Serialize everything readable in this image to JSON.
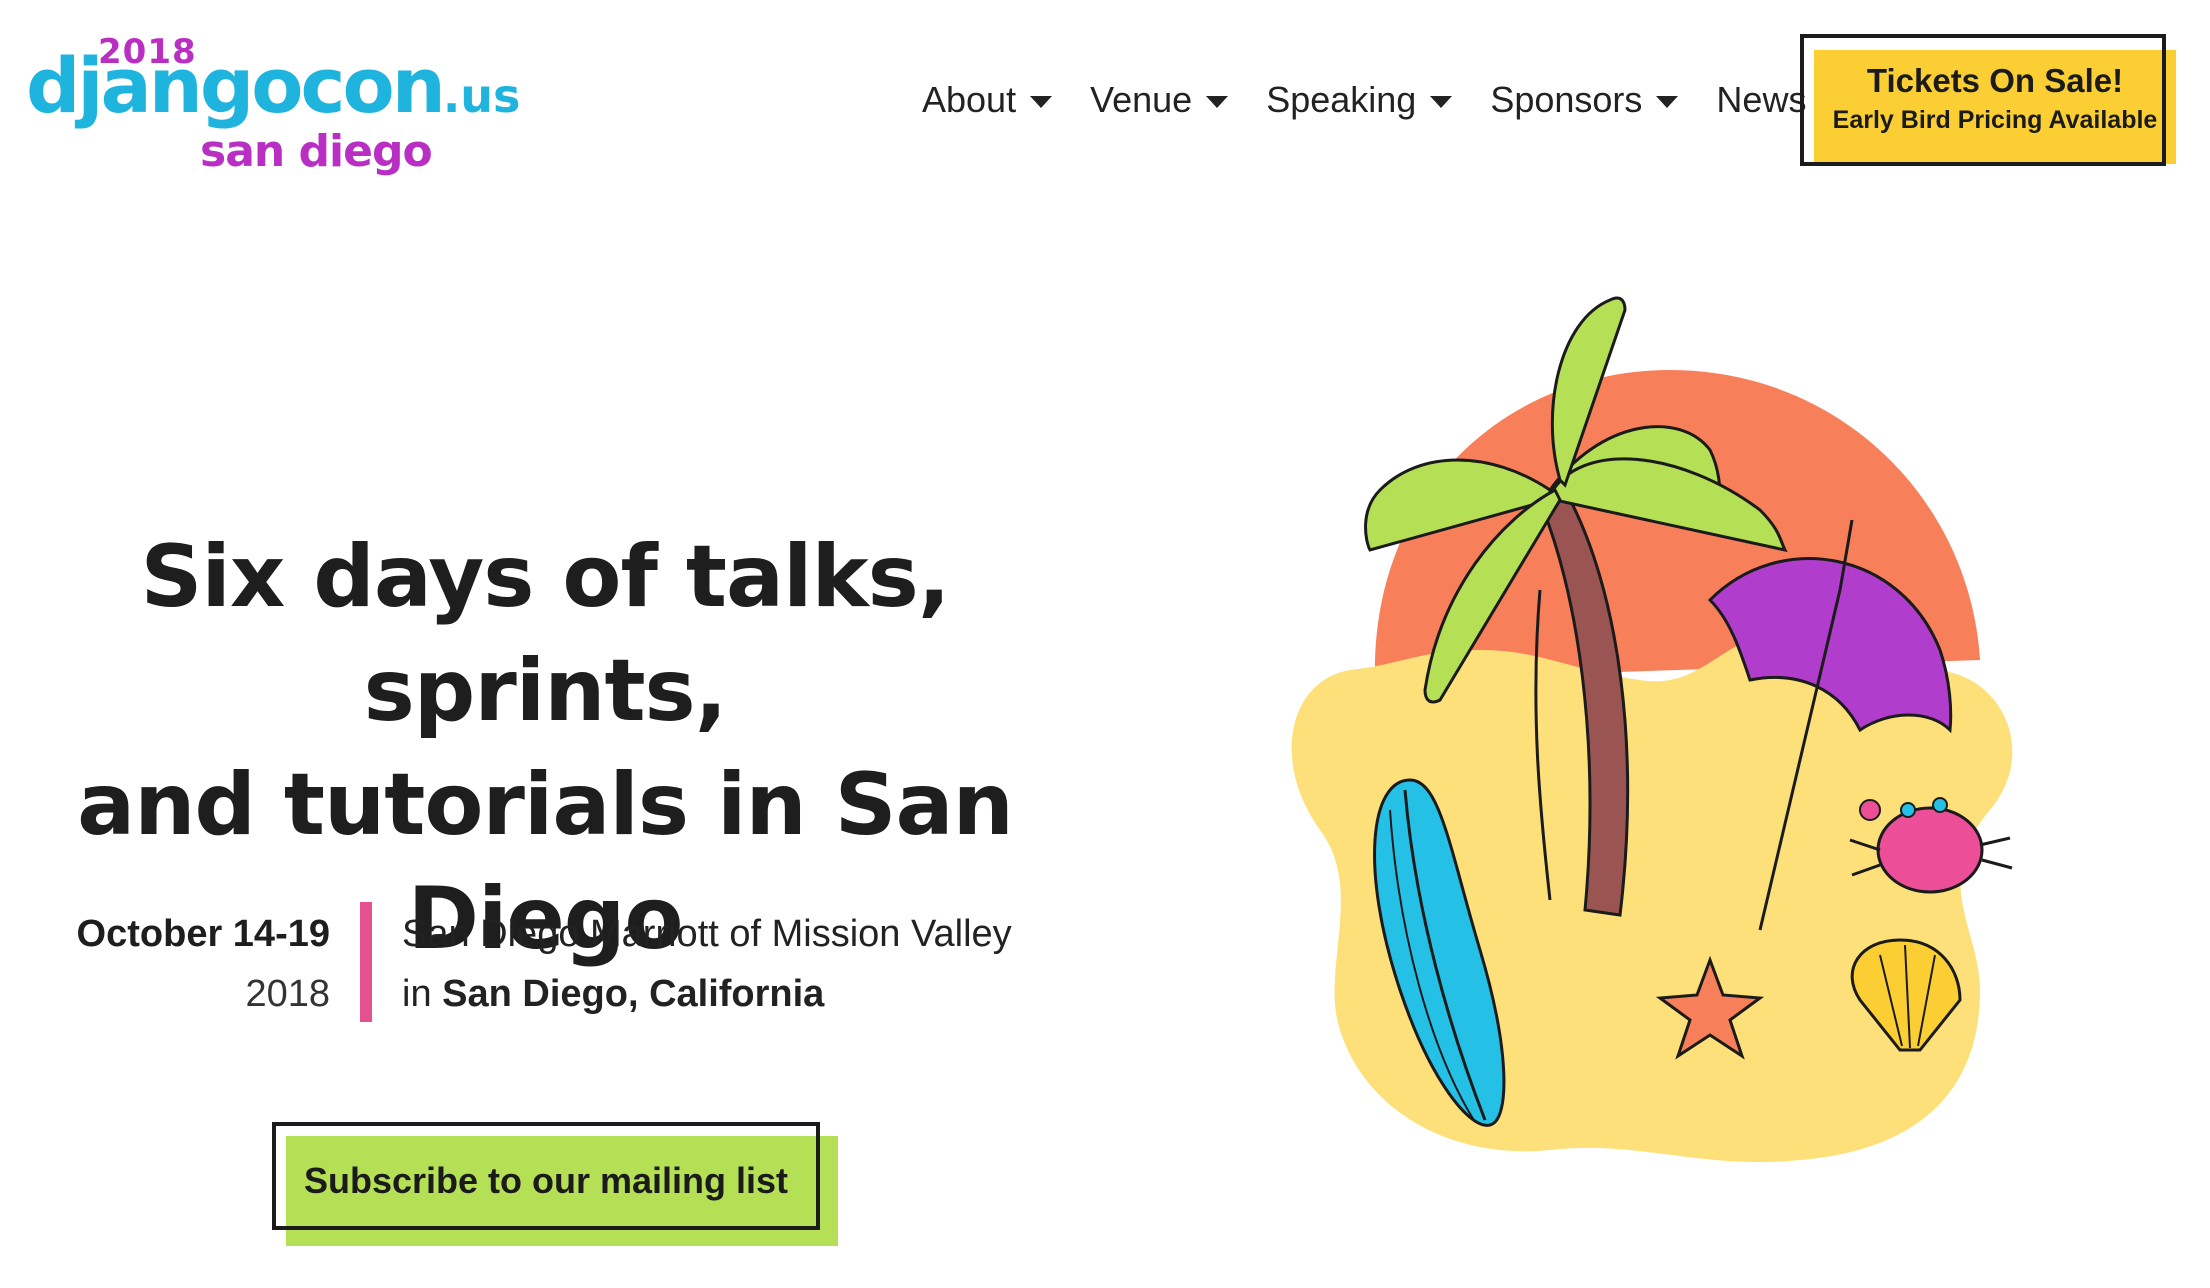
{
  "logo": {
    "year": "2018",
    "wordmark": "djangocon",
    "suffix": ".us",
    "city": "san diego"
  },
  "nav": {
    "items": [
      {
        "label": "About",
        "dropdown": true
      },
      {
        "label": "Venue",
        "dropdown": true
      },
      {
        "label": "Speaking",
        "dropdown": true
      },
      {
        "label": "Sponsors",
        "dropdown": true
      },
      {
        "label": "News",
        "dropdown": false
      }
    ]
  },
  "tickets": {
    "title": "Tickets On Sale!",
    "subtitle": "Early Bird Pricing Available"
  },
  "hero": {
    "headline_lines": [
      "Six days of talks, sprints,",
      "and tutorials in San",
      "Diego"
    ],
    "date": "October 14-19",
    "year": "2018",
    "venue": "San Diego Marriott of Mission Valley",
    "location_prefix": "in",
    "location": "San Diego, California"
  },
  "subscribe": {
    "label": "Subscribe to our mailing list"
  },
  "colors": {
    "brand_blue": "#1fb4dd",
    "brand_purple": "#b92fc3",
    "ticket_yellow": "#fbcf33",
    "subscribe_green": "#b5e055",
    "divider_pink": "#e5508f",
    "sun_orange": "#f77f5a",
    "sand_yellow": "#fde07a"
  },
  "illustration": {
    "icons": [
      "sun-icon",
      "palm-tree-icon",
      "beach-umbrella-icon",
      "surfboard-icon",
      "crab-icon",
      "starfish-icon",
      "seashell-icon"
    ]
  }
}
